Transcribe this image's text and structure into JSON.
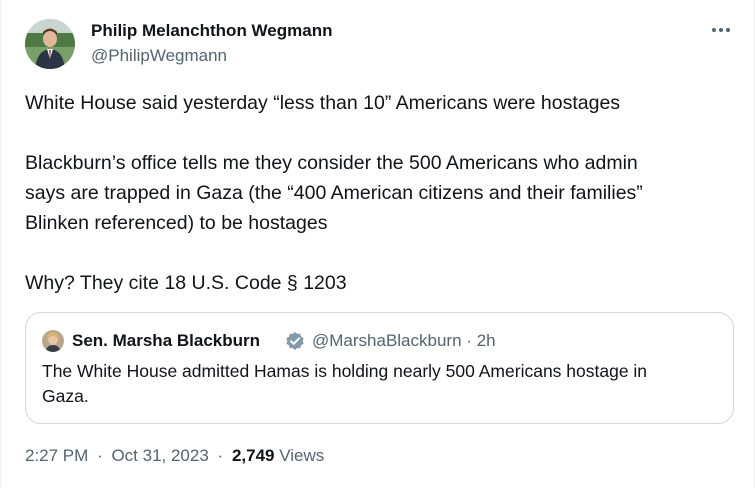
{
  "author": {
    "name": "Philip Melanchthon Wegmann",
    "handle": "@PhilipWegmann"
  },
  "more_icon": "ellipsis-icon",
  "tweet": {
    "line1": "White House said yesterday “less than 10” Americans were hostages",
    "line2": "Blackburn’s office tells me they consider the 500 Americans who admin",
    "line3": "says are trapped in Gaza (the “400 American citizens and their families”",
    "line4": "Blinken referenced) to be hostages",
    "line5": "Why? They cite 18 U.S. Code § 1203"
  },
  "quote": {
    "name": "Sen. Marsha Blackburn",
    "badge_icon": "government-verified-badge-icon",
    "handle": "@MarshaBlackburn",
    "separator": "·",
    "age": "2h",
    "text_line1": "The White House admitted Hamas is holding nearly 500 Americans hostage in",
    "text_line2": "Gaza."
  },
  "meta": {
    "time": "2:27 PM",
    "dot1": "·",
    "date": "Oct 31, 2023",
    "dot2": "·",
    "views_count": "2,749",
    "views_label": "Views"
  },
  "colors": {
    "text": "#0f1419",
    "secondary": "#536471",
    "border": "#cfd9de",
    "badge": "#829aab"
  }
}
